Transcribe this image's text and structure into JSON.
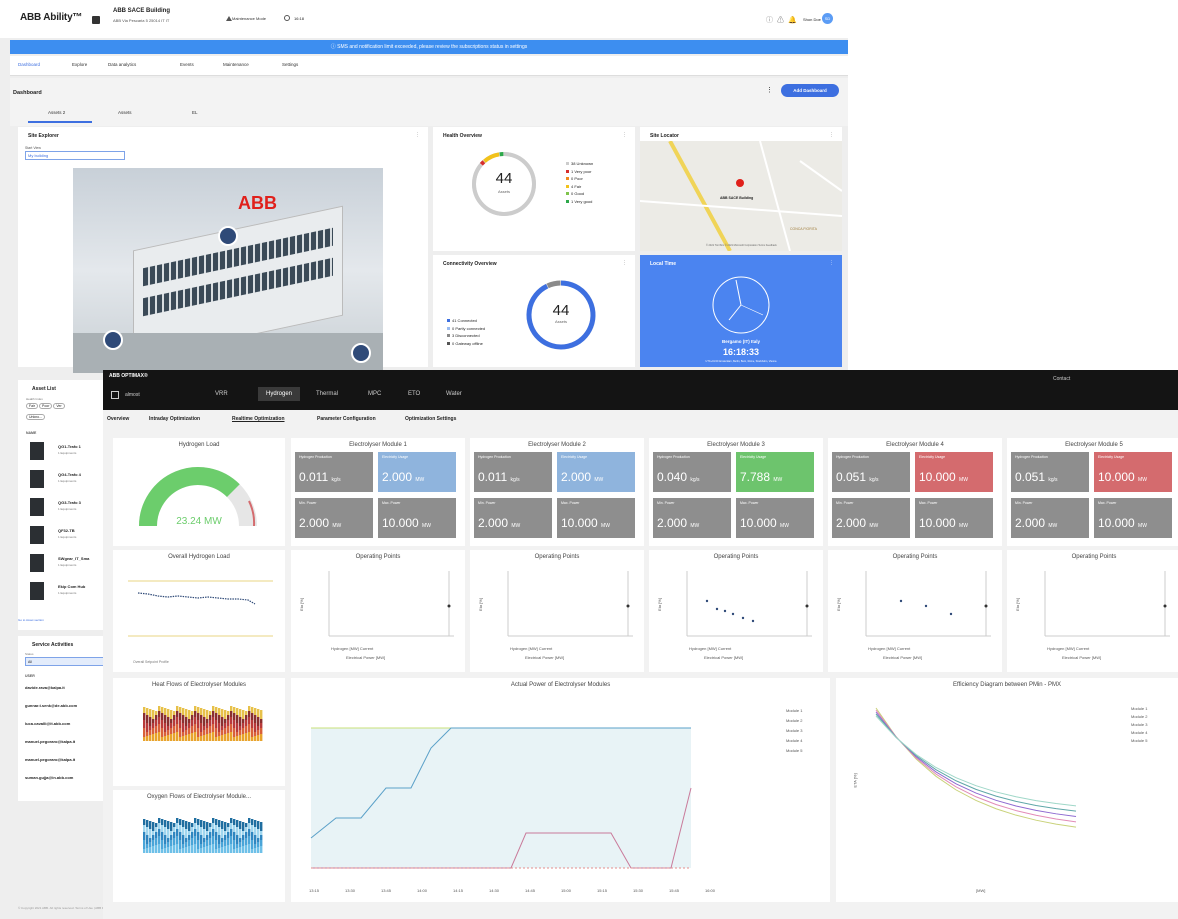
{
  "header": {
    "logo": "ABB Ability™",
    "building": "ABB SACE Building",
    "address": "ABB Via Pescaria 5 25014 IT IT",
    "maintenance": "Maintenance Mode",
    "time": "16:18",
    "user": "Shon Doe",
    "avatar": "SD"
  },
  "notification": "SMS and notification limit exceeded, please review the subscriptions status in settings",
  "nav": [
    "Dashboard",
    "Explore",
    "Data analytics",
    "Events",
    "Maintenance",
    "Settings"
  ],
  "dashboard": {
    "title": "Dashboard",
    "add_label": "Add Dashboard",
    "tabs": [
      "Assets 2",
      "Assets",
      "EL"
    ]
  },
  "site_explorer": {
    "title": "Site Explorer",
    "start_view_label": "Start View",
    "start_view": "My building"
  },
  "health": {
    "title": "Health Overview",
    "total": "44",
    "sub": "Assets",
    "legend": [
      {
        "label": "38 Unknown",
        "color": "#cccccc"
      },
      {
        "label": "1 Very poor",
        "color": "#d62d2d"
      },
      {
        "label": "0 Poor",
        "color": "#f08a1c"
      },
      {
        "label": "4 Fair",
        "color": "#f2c21b"
      },
      {
        "label": "0 Good",
        "color": "#7fc44b"
      },
      {
        "label": "1 Very good",
        "color": "#2da84a"
      }
    ]
  },
  "locator": {
    "title": "Site Locator",
    "pin": "ABB SACE Building",
    "area": "CONCA FIORITA",
    "credits": "© 2021 TomTom © 2021 Microsoft Corporation Terms Feedback"
  },
  "connectivity": {
    "title": "Connectivity Overview",
    "total": "44",
    "sub": "Assets",
    "legend": [
      {
        "label": "41 Connected",
        "color": "#3d6fe0"
      },
      {
        "label": "0 Partly connected",
        "color": "#9bbcf0"
      },
      {
        "label": "3 Disconnected",
        "color": "#8a8a8a"
      },
      {
        "label": "0 Gateway offline",
        "color": "#555555"
      }
    ]
  },
  "local_time": {
    "title": "Local Time",
    "city": "Bergamo (IT) Italy",
    "time": "16:18:33",
    "zone": "UTC+01:00 Amsterdam, Berlin, Bern, Rome, Stockholm, Vienna"
  },
  "asset_list": {
    "title": "Asset List",
    "filter_label": "Health Index",
    "chips": [
      "Fair",
      "Poor",
      "Ver",
      "Unkno..."
    ],
    "col": "NAME",
    "items": [
      {
        "name": "QG1-Trafo 1",
        "sub": "1 Equipments"
      },
      {
        "name": "QG4-Trafo 4",
        "sub": "1 Equipments"
      },
      {
        "name": "QG3-Trafo 3",
        "sub": "1 Equipments"
      },
      {
        "name": "QF32-TB",
        "sub": "1 Equipments"
      },
      {
        "name": "SWgear_IT_Sma",
        "sub": "1 Equipments"
      },
      {
        "name": "Ekip Com Hub",
        "sub": "1 Equipments"
      }
    ],
    "link": "Go to Asset section"
  },
  "service": {
    "title": "Service Activities",
    "status_label": "Status",
    "status": "All",
    "col": "USER",
    "users": [
      "davide.rava@kalpa.it",
      "gunnar.t.senk@de.abb.com",
      "luca.cavalli@it.abb.com",
      "manuel.pegoraro@kalpa.it",
      "manuel.pegoraro@kalpa.it",
      "suman.gujja@in.abb.com"
    ]
  },
  "footer": "© Copyright 2021 ABB. All rights reserved.  Terms of Use  |  ABB Privacy Policy  |  ABB Ability Terms and Conditions  |  Terms of use  |  Accessibility statement  |  Security Terms and Conditions  |  Contact us",
  "overlay": {
    "logo": "ABB OPTIMAX®",
    "site": "almost",
    "user": "Contact",
    "tabs": [
      "VRR",
      "Hydrogen",
      "Thermal",
      "MPC",
      "ETO",
      "Water"
    ],
    "subtabs": [
      "Overview",
      "Intraday Optimization",
      "Realtime Optimization",
      "Parameter Configuration",
      "Optimization Settings"
    ],
    "hydrogen_load": {
      "title": "Hydrogen Load",
      "value": "23.24 MW",
      "fraction": 0.75
    },
    "modules": [
      {
        "title": "Electrolyser Module 1",
        "h2": "0.011",
        "h2u": "kg/s",
        "pw": "2.000",
        "pwu": "MW",
        "pw_color": "b",
        "min": "2.000",
        "max": "10.000"
      },
      {
        "title": "Electrolyser Module 2",
        "h2": "0.011",
        "h2u": "kg/s",
        "pw": "2.000",
        "pwu": "MW",
        "pw_color": "b",
        "min": "2.000",
        "max": "10.000"
      },
      {
        "title": "Electrolyser Module 3",
        "h2": "0.040",
        "h2u": "kg/s",
        "pw": "7.788",
        "pwu": "MW",
        "pw_color": "gr",
        "min": "2.000",
        "max": "10.000"
      },
      {
        "title": "Electrolyser Module 4",
        "h2": "0.051",
        "h2u": "kg/s",
        "pw": "10.000",
        "pwu": "MW",
        "pw_color": "r",
        "min": "2.000",
        "max": "10.000"
      },
      {
        "title": "Electrolyser Module 5",
        "h2": "0.051",
        "h2u": "kg/s",
        "pw": "10.000",
        "pwu": "MW",
        "pw_color": "r",
        "min": "2.000",
        "max": "10.000"
      }
    ],
    "tile_labels": {
      "h2": "Hydrogen Production",
      "pw": "Electricity Usage",
      "min": "Min. Power",
      "max": "Max. Power"
    },
    "op_title": "Operating Points",
    "op_xlabel": "Electrical Power [MW]",
    "op_ylabel": "Eta [%]",
    "op_legend": [
      "Hydrogen [MW]",
      "Current"
    ],
    "overall_title": "Overall Hydrogen Load",
    "overall_legend": "Overall Setpoint Profile",
    "heat_title": "Heat Flows of Electrolyser Modules",
    "oxy_title": "Oxygen Flows of Electrolyser Module...",
    "actual_title": "Actual Power of Electrolyser Modules",
    "actual_legend": [
      "Module 1",
      "Module 2",
      "Module 3",
      "Module 4",
      "Module 5"
    ],
    "actual_xticks": [
      "13:15",
      "13:30",
      "13:45",
      "14:00",
      "14:15",
      "14:30",
      "14:45",
      "15:00",
      "15:15",
      "15:30",
      "15:45",
      "16:00"
    ],
    "eff_title": "Efficiency Diagram between PMin - PMX",
    "eff_xlabel": "[MW]",
    "eff_ylabel": "ETA [%]",
    "eff_legend": [
      "Module 1",
      "Module 2",
      "Module 3",
      "Module 4",
      "Module 5"
    ]
  }
}
